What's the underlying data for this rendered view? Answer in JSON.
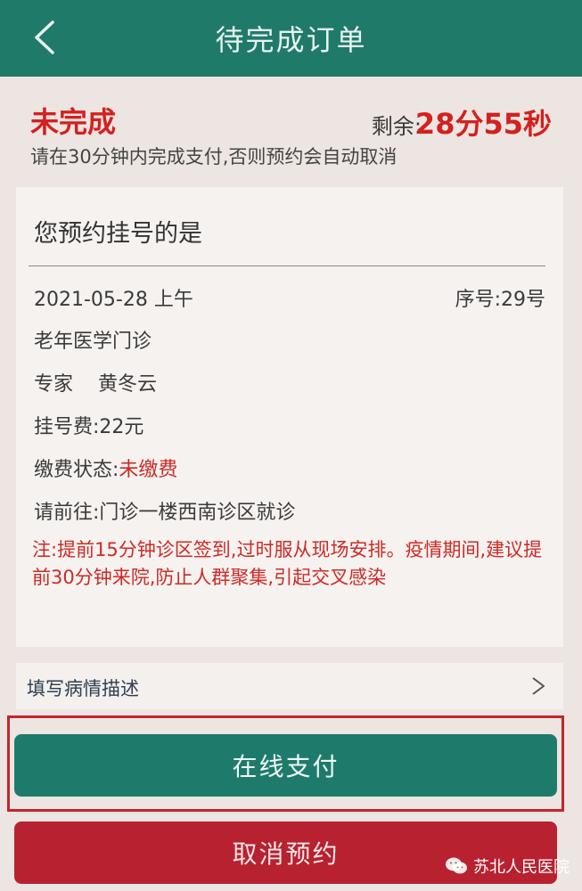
{
  "header": {
    "title": "待完成订单",
    "back_icon": "chevron-left-icon"
  },
  "status": {
    "label": "未完成",
    "remaining_label": "剩余:",
    "remaining_time": "28分55秒",
    "notice": "请在30分钟内完成支付,否则预约会自动取消"
  },
  "card": {
    "title": "您预约挂号的是",
    "date": "2021-05-28 上午",
    "serial_label": "序号:",
    "serial_value": "29号",
    "department": "老年医学门诊",
    "doctor_title": "专家",
    "doctor_name": "黄冬云",
    "fee_label": "挂号费:",
    "fee_value": "22元",
    "payment_status_label": "缴费状态:",
    "payment_status_value": "未缴费",
    "goto_label": "请前往:",
    "goto_value": "门诊一楼西南诊区就诊",
    "note": "注:提前15分钟诊区签到,过时服从现场安排。疫情期间,建议提前30分钟来院,防止人群聚集,引起交叉感染"
  },
  "describe_row": {
    "label": "填写病情描述",
    "chevron": ">"
  },
  "actions": {
    "pay_label": "在线支付",
    "cancel_label": "取消预约"
  },
  "watermark": {
    "text": "苏北人民医院",
    "icon": "wechat-icon"
  },
  "colors": {
    "header": "#1f7a6a",
    "accent_red": "#d3211f",
    "pay_button": "#1e7b6b",
    "cancel_button": "#b82130",
    "highlight_border": "#c3262a"
  }
}
